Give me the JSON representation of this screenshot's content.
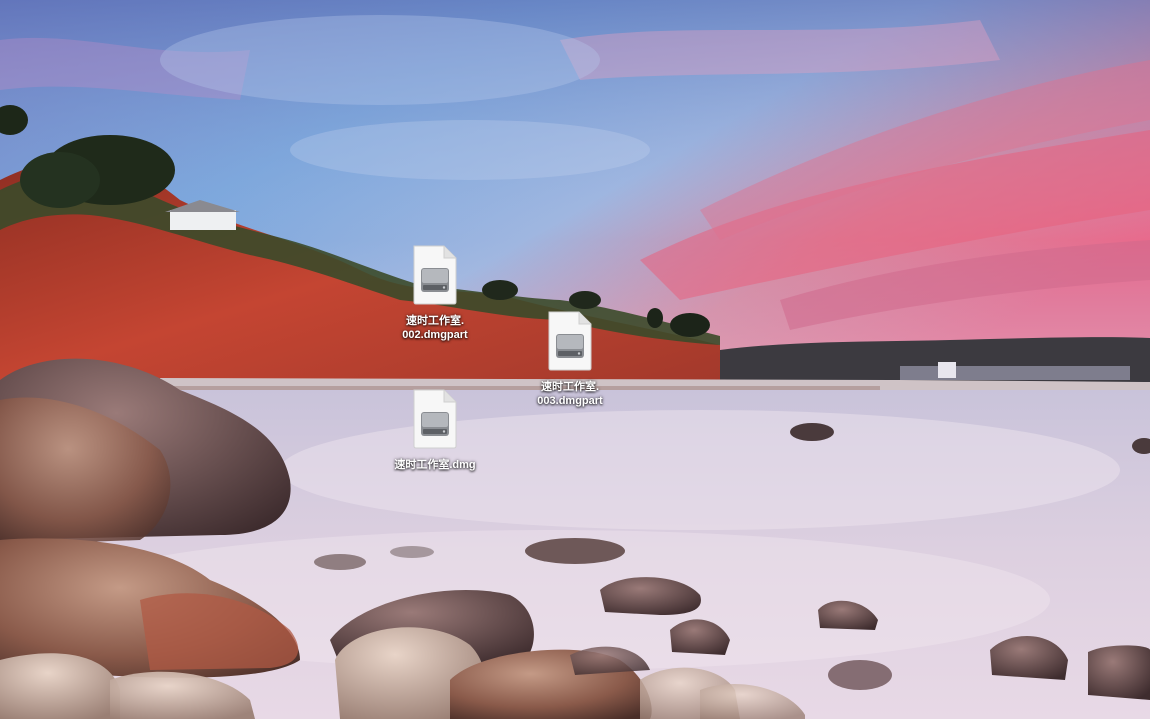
{
  "desktop": {
    "files": [
      {
        "id": "icon-1",
        "name": "速时工作室.\n002.dmgpart",
        "icon": "disk-image-icon"
      },
      {
        "id": "icon-2",
        "name": "速时工作室.\n003.dmgpart",
        "icon": "disk-image-icon"
      },
      {
        "id": "icon-3",
        "name": "速时工作室.dmg",
        "icon": "disk-image-icon"
      }
    ]
  },
  "colors": {
    "label_text": "#ffffff",
    "sky_top": "#5a74b8",
    "sky_pink": "#e86a8c",
    "cliff_red": "#b33a2a",
    "water": "#d9c7d9"
  }
}
